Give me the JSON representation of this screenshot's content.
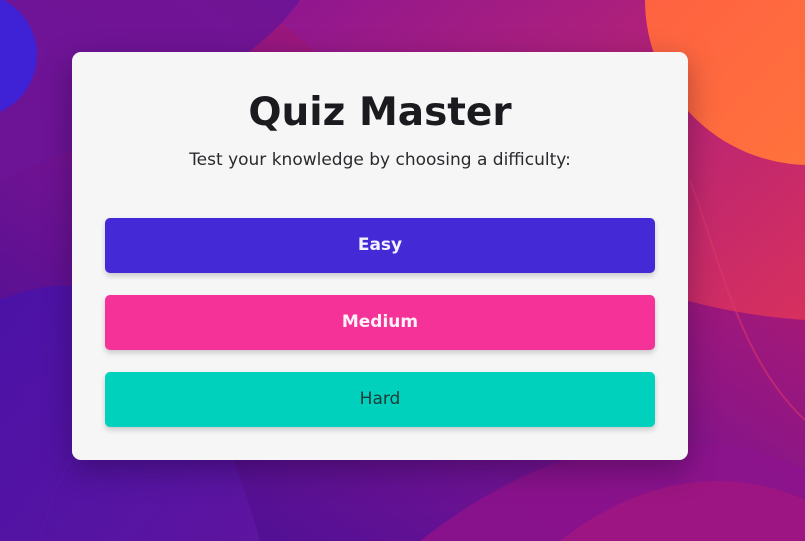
{
  "app": {
    "title": "Quiz Master",
    "subtitle": "Test your knowledge by choosing a difficulty:"
  },
  "difficulties": [
    {
      "label": "Easy",
      "color": "#432ad6",
      "text_color": "#f4f2ff",
      "font_weight": "bold"
    },
    {
      "label": "Medium",
      "color": "#f53298",
      "text_color": "#fff2f8",
      "font_weight": "bold"
    },
    {
      "label": "Hard",
      "color": "#00d1bc",
      "text_color": "#1e3a38",
      "font_weight": "normal"
    }
  ],
  "theme": {
    "card_background": "#f6f6f7",
    "background_colors": [
      "#3a0f9a",
      "#7a1290",
      "#c2185b",
      "#ff6a3d"
    ]
  }
}
